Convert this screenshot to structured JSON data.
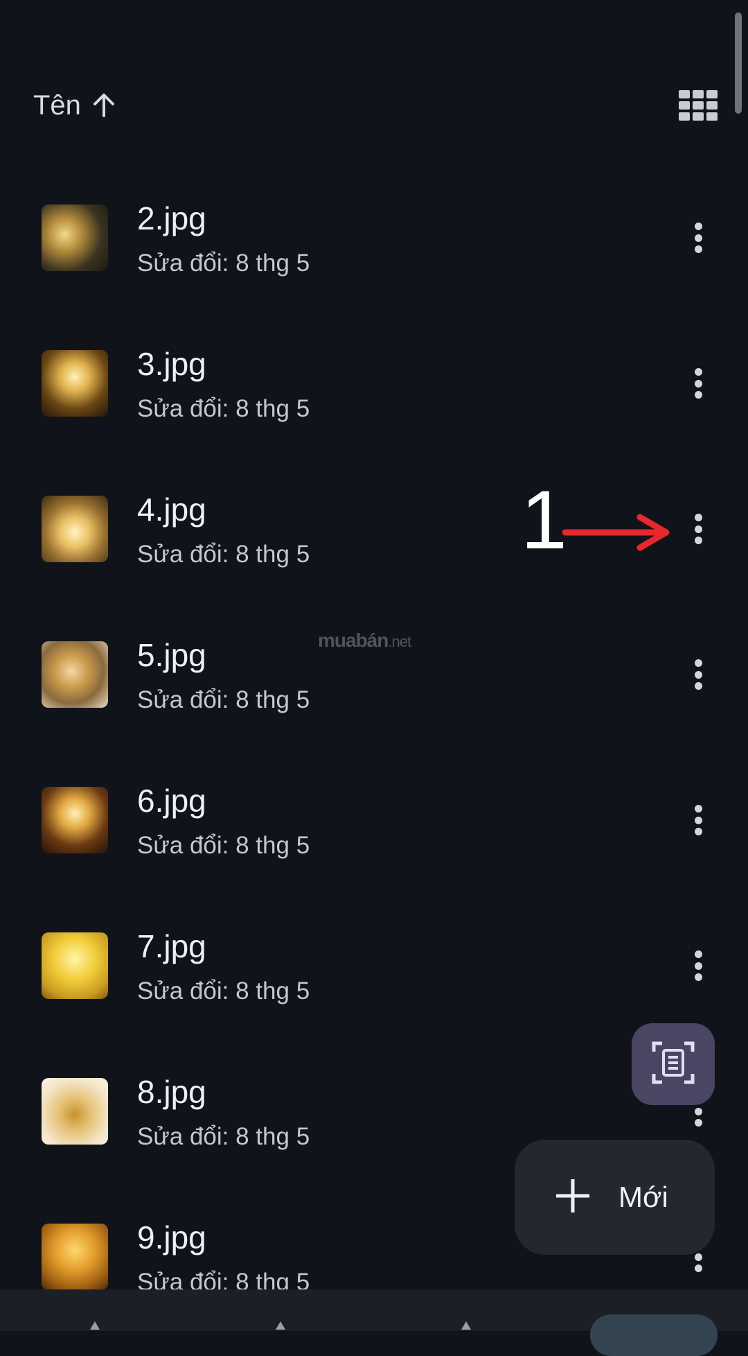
{
  "sort": {
    "label": "Tên",
    "direction_icon": "arrow-up-icon"
  },
  "view_toggle": {
    "icon": "grid-view-icon"
  },
  "files": [
    {
      "name": "2.jpg",
      "meta": "Sửa đổi: 8 thg 5",
      "thumb_theme": "gold-tree-night"
    },
    {
      "name": "3.jpg",
      "meta": "Sửa đổi: 8 thg 5",
      "thumb_theme": "gold-lotus"
    },
    {
      "name": "4.jpg",
      "meta": "Sửa đổi: 8 thg 5",
      "thumb_theme": "gold-buddha"
    },
    {
      "name": "5.jpg",
      "meta": "Sửa đổi: 8 thg 5",
      "thumb_theme": "gold-dragon"
    },
    {
      "name": "6.jpg",
      "meta": "Sửa đổi: 8 thg 5",
      "thumb_theme": "gold-lotus-dark"
    },
    {
      "name": "7.jpg",
      "meta": "Sửa đổi: 8 thg 5",
      "thumb_theme": "gold-tree-bright"
    },
    {
      "name": "8.jpg",
      "meta": "Sửa đổi: 8 thg 5",
      "thumb_theme": "gold-ship"
    },
    {
      "name": "9.jpg",
      "meta": "Sửa đổi: 8 thg 5",
      "thumb_theme": "gold-forest"
    }
  ],
  "annotation": {
    "number": "1",
    "color": "#e8282b"
  },
  "watermark": {
    "main": "muabán",
    "suffix": ".net"
  },
  "scan_fab": {
    "icon": "document-scan-icon"
  },
  "new_fab": {
    "label": "Mới",
    "icon": "plus-icon"
  },
  "colors": {
    "background": "#10141a",
    "fab_scan": "#4a4563",
    "fab_new": "#232830"
  }
}
